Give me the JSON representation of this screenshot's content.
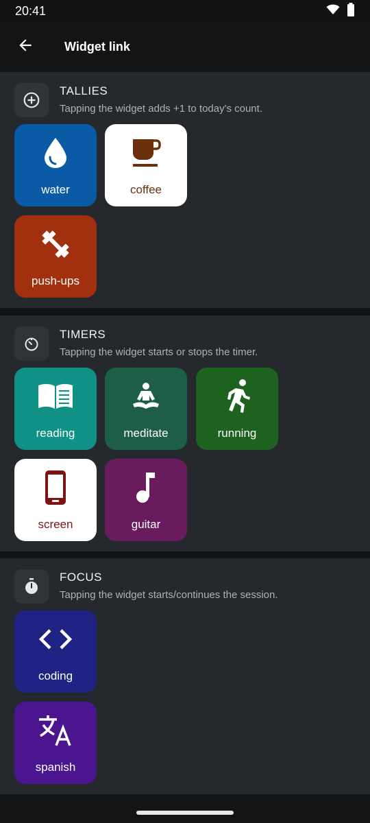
{
  "status": {
    "time": "20:41"
  },
  "appbar": {
    "title": "Widget link"
  },
  "colors": {
    "background": "#121416",
    "section": "#25282c",
    "water": "#0a5aa6",
    "coffee": "#ffffff",
    "coffee_fg": "#6b2f0c",
    "pushups": "#a1300e",
    "reading": "#0f9186",
    "meditate": "#1e5e47",
    "running": "#1e621f",
    "screen": "#ffffff",
    "screen_fg": "#7d1414",
    "guitar": "#6a1b5e",
    "coding": "#1f2383",
    "spanish": "#4b1590"
  },
  "sections": [
    {
      "title": "TALLIES",
      "subtitle": "Tapping the widget adds +1 to today's count.",
      "icon": "add-circle-icon",
      "tiles": [
        {
          "label": "water",
          "icon": "water-drop-icon"
        },
        {
          "label": "coffee",
          "icon": "coffee-cup-icon"
        },
        {
          "label": "push-ups",
          "icon": "dumbbell-icon"
        }
      ]
    },
    {
      "title": "TIMERS",
      "subtitle": "Tapping the widget starts or stops the timer.",
      "icon": "timer-icon",
      "tiles": [
        {
          "label": "reading",
          "icon": "book-icon"
        },
        {
          "label": "meditate",
          "icon": "meditation-icon"
        },
        {
          "label": "running",
          "icon": "running-icon"
        },
        {
          "label": "screen",
          "icon": "phone-icon"
        },
        {
          "label": "guitar",
          "icon": "music-note-icon"
        }
      ]
    },
    {
      "title": "FOCUS",
      "subtitle": "Tapping the widget starts/continues the session.",
      "icon": "stopwatch-icon",
      "tiles": [
        {
          "label": "coding",
          "icon": "code-icon"
        },
        {
          "label": "spanish",
          "icon": "translate-icon"
        }
      ]
    }
  ]
}
